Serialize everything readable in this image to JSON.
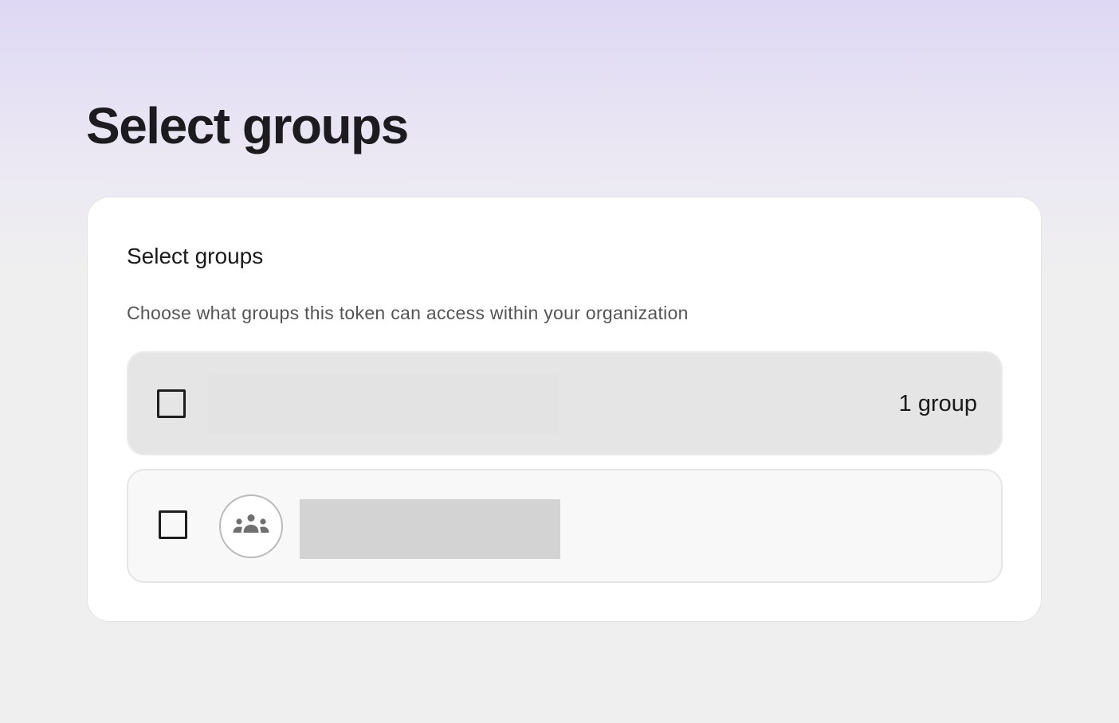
{
  "page": {
    "title": "Select groups"
  },
  "card": {
    "title": "Select groups",
    "subtitle": "Choose what groups this token can access within your organization"
  },
  "select_all_row": {
    "count_label": "1 group",
    "checked": false
  },
  "group_rows": [
    {
      "icon": "group-icon",
      "checked": false
    }
  ],
  "colors": {
    "header_gradient_top": "#ded8f4",
    "page_background": "#efefef",
    "card_background": "#ffffff",
    "select_all_background": "#e5e5e5",
    "group_row_background": "#f8f8f8",
    "icon_color": "#707070"
  }
}
